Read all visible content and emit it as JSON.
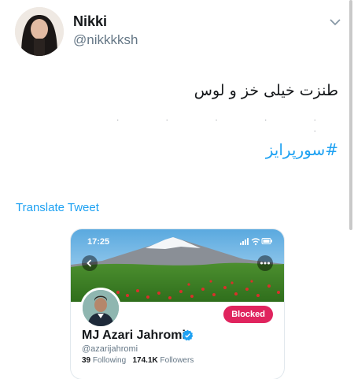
{
  "author": {
    "display_name": "Nikki",
    "handle": "@nikkkksh"
  },
  "tweet": {
    "text": "طنزت خیلی خز و لوس ",
    "hashtag": "#سورپرایز"
  },
  "translate_label": "Translate Tweet",
  "embedded_profile": {
    "status_time": "17:25",
    "name": "MJ Azari Jahromi",
    "handle": "@azarijahromi",
    "following_count": "39",
    "following_label": "Following",
    "followers_count": "174.1K",
    "followers_label": "Followers",
    "blocked_label": "Blocked",
    "verified_color": "#1da1f2",
    "blocked_color": "#e0245e"
  },
  "icons": [
    "chevron-down-icon",
    "back-arrow-icon",
    "more-icon",
    "verified-icon",
    "signal-icon",
    "wifi-icon",
    "battery-icon"
  ]
}
